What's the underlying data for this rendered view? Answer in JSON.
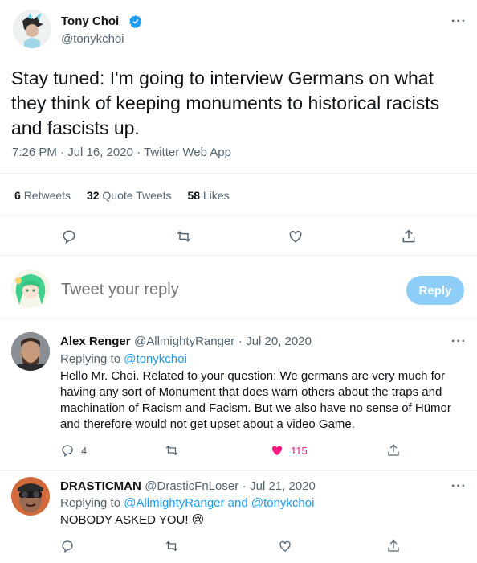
{
  "main_tweet": {
    "author_name": "Tony Choi",
    "author_handle": "@tonykchoi",
    "text": "Stay tuned: I'm going to interview Germans on what they think of keeping monuments to historical racists and fascists up.",
    "time": "7:26 PM",
    "date": "Jul 16, 2020",
    "source": "Twitter Web App",
    "stats": {
      "retweets_count": "6",
      "retweets_label": "Retweets",
      "quotes_count": "32",
      "quotes_label": "Quote Tweets",
      "likes_count": "58",
      "likes_label": "Likes"
    }
  },
  "compose": {
    "placeholder": "Tweet your reply",
    "button_label": "Reply"
  },
  "replies": [
    {
      "name": "Alex Renger",
      "handle": "@AllmightyRanger",
      "date": "Jul 20, 2020",
      "replying_prefix": "Replying to",
      "replying_to": "@tonykchoi",
      "lines": [
        "Hello Mr. Choi. Related to your question: We germans are very much for",
        "having any sort of Monument that does warn others about the traps and",
        "machination of Racism and Facism. But we also have no sense of Hümor",
        "and therefore would not get upset about a video Game."
      ],
      "reply_count": "4",
      "like_count": "115"
    },
    {
      "name": "DRASTICMAN",
      "handle": "@DrasticFnLoser",
      "date": "Jul 21, 2020",
      "replying_prefix": "Replying to",
      "replying_to": "@AllmightyRanger and @tonykchoi",
      "lines": [
        "NOBODY ASKED YOU! 😢"
      ]
    }
  ],
  "separator_dot": "·",
  "more_glyph": "···",
  "colors": {
    "accent": "#1d9bf0",
    "reply_button_disabled": "#8ecdf7",
    "like_active": "#f91880",
    "muted_text": "#536471",
    "divider": "#eff3f4"
  },
  "icons": [
    "verified-badge-icon",
    "reply-icon",
    "retweet-icon",
    "like-icon",
    "share-icon",
    "more-icon"
  ]
}
